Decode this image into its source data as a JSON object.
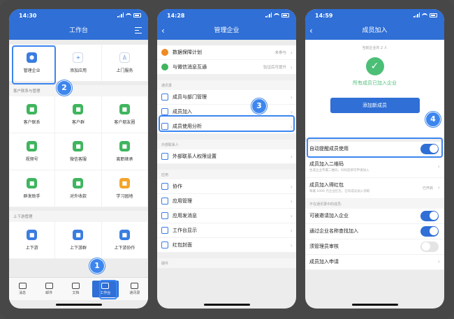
{
  "phone1": {
    "time": "14:30",
    "title": "工作台",
    "top": [
      {
        "label": "管理企业",
        "color": "#3a7de0",
        "glyph": "⬢"
      },
      {
        "label": "添加应用",
        "color": "#ffffff",
        "glyph": "+"
      },
      {
        "label": "上门服务",
        "color": "#ffffff",
        "glyph": "♙"
      }
    ],
    "section1": "客户联系与管理",
    "grid1": [
      {
        "label": "客户联系",
        "color": "#3fb55e"
      },
      {
        "label": "客户群",
        "color": "#3fb55e"
      },
      {
        "label": "客户朋友圈",
        "color": "#3fb55e"
      },
      {
        "label": "视频号",
        "color": "#3fb55e"
      },
      {
        "label": "微信客服",
        "color": "#3fb55e"
      },
      {
        "label": "离职继承",
        "color": "#3fb55e"
      },
      {
        "label": "群发助手",
        "color": "#3fb55e"
      },
      {
        "label": "对外收款",
        "color": "#3fb55e"
      },
      {
        "label": "学习园地",
        "color": "#f3a52a"
      }
    ],
    "section2": "上下游管理",
    "grid2": [
      {
        "label": "上下游",
        "color": "#3a7de0"
      },
      {
        "label": "上下游群",
        "color": "#3a7de0"
      },
      {
        "label": "上下游协作",
        "color": "#3a7de0"
      }
    ],
    "tabs": [
      "消息",
      "邮件",
      "文档",
      "工作台",
      "通讯录"
    ],
    "badge2": "2",
    "badge1": "1"
  },
  "phone2": {
    "time": "14:28",
    "title": "管理企业",
    "top": [
      {
        "label": "数据保障计划",
        "right": "未参与",
        "color": "#f08a24"
      },
      {
        "label": "与微信消息互通",
        "right": "验证后可提升",
        "color": "#3fb55e"
      }
    ],
    "group1": "通讯录",
    "list1": [
      {
        "label": "成员与部门管理"
      },
      {
        "label": "成员加入"
      },
      {
        "label": "成员使用分析"
      }
    ],
    "group2": "外部联系人",
    "list2": [
      {
        "label": "外部联系人权限设置"
      }
    ],
    "group3": "应用",
    "list3": [
      {
        "label": "协作"
      },
      {
        "label": "应用管理"
      },
      {
        "label": "应用发消息"
      },
      {
        "label": "工作台显示"
      },
      {
        "label": "红包封面"
      }
    ],
    "group4": "硬件",
    "badge3": "3"
  },
  "phone3": {
    "time": "14:59",
    "title": "成员加入",
    "hint": "当前企业共 2 人",
    "ok": "所有成员已加入企业",
    "add_button": "添加新成员",
    "rows": [
      {
        "title": "自动提醒成员使用",
        "sub": "",
        "toggle": true
      },
      {
        "title": "成员加入二维码",
        "sub": "生成企业专属二维码，扫码后即可申请加入"
      },
      {
        "title": "成员加入得红包",
        "sub": "每邀 1000 元企业红包，已有成员加入领取",
        "right": "已开启"
      }
    ],
    "group": "不在通讯录中的成员:",
    "rows2": [
      {
        "title": "可被邀请加入企业",
        "toggle": true
      },
      {
        "title": "通过企业名称查找加入",
        "toggle": true
      },
      {
        "title": "须管理员审核",
        "toggle": false
      },
      {
        "title": "成员加入申请"
      }
    ],
    "badge4": "4"
  }
}
